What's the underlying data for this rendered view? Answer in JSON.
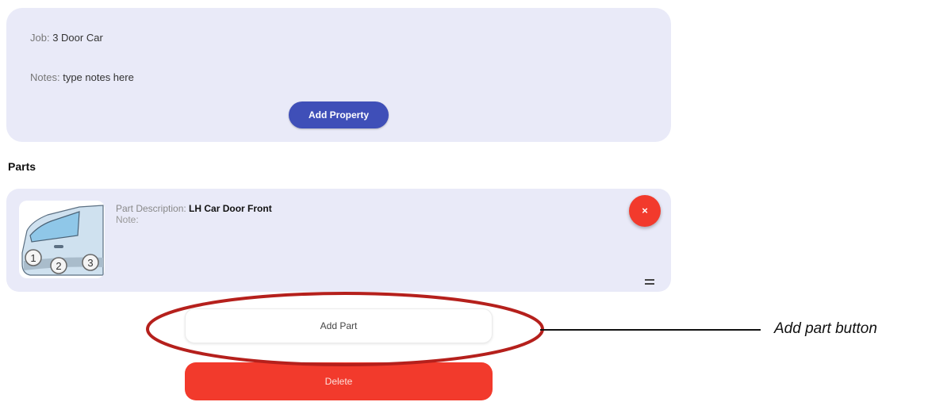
{
  "job": {
    "job_label": "Job:",
    "job_value": "3 Door Car",
    "notes_label": "Notes:",
    "notes_value": "type notes here",
    "add_property_label": "Add Property"
  },
  "parts": {
    "heading": "Parts",
    "items": [
      {
        "description_label": "Part Description:",
        "description_value": "LH Car Door Front",
        "note_label": "Note:",
        "image_callouts": [
          "1",
          "2",
          "3"
        ],
        "remove_label": "×",
        "drag_handle_icon": "drag-handle-icon"
      }
    ]
  },
  "actions": {
    "add_part_label": "Add Part",
    "delete_label": "Delete"
  },
  "annotation": {
    "label": "Add part button"
  },
  "colors": {
    "card_bg": "#e9eaf8",
    "primary": "#3f4fb8",
    "danger": "#f23a2c",
    "annotation_ring": "#b5201c"
  }
}
